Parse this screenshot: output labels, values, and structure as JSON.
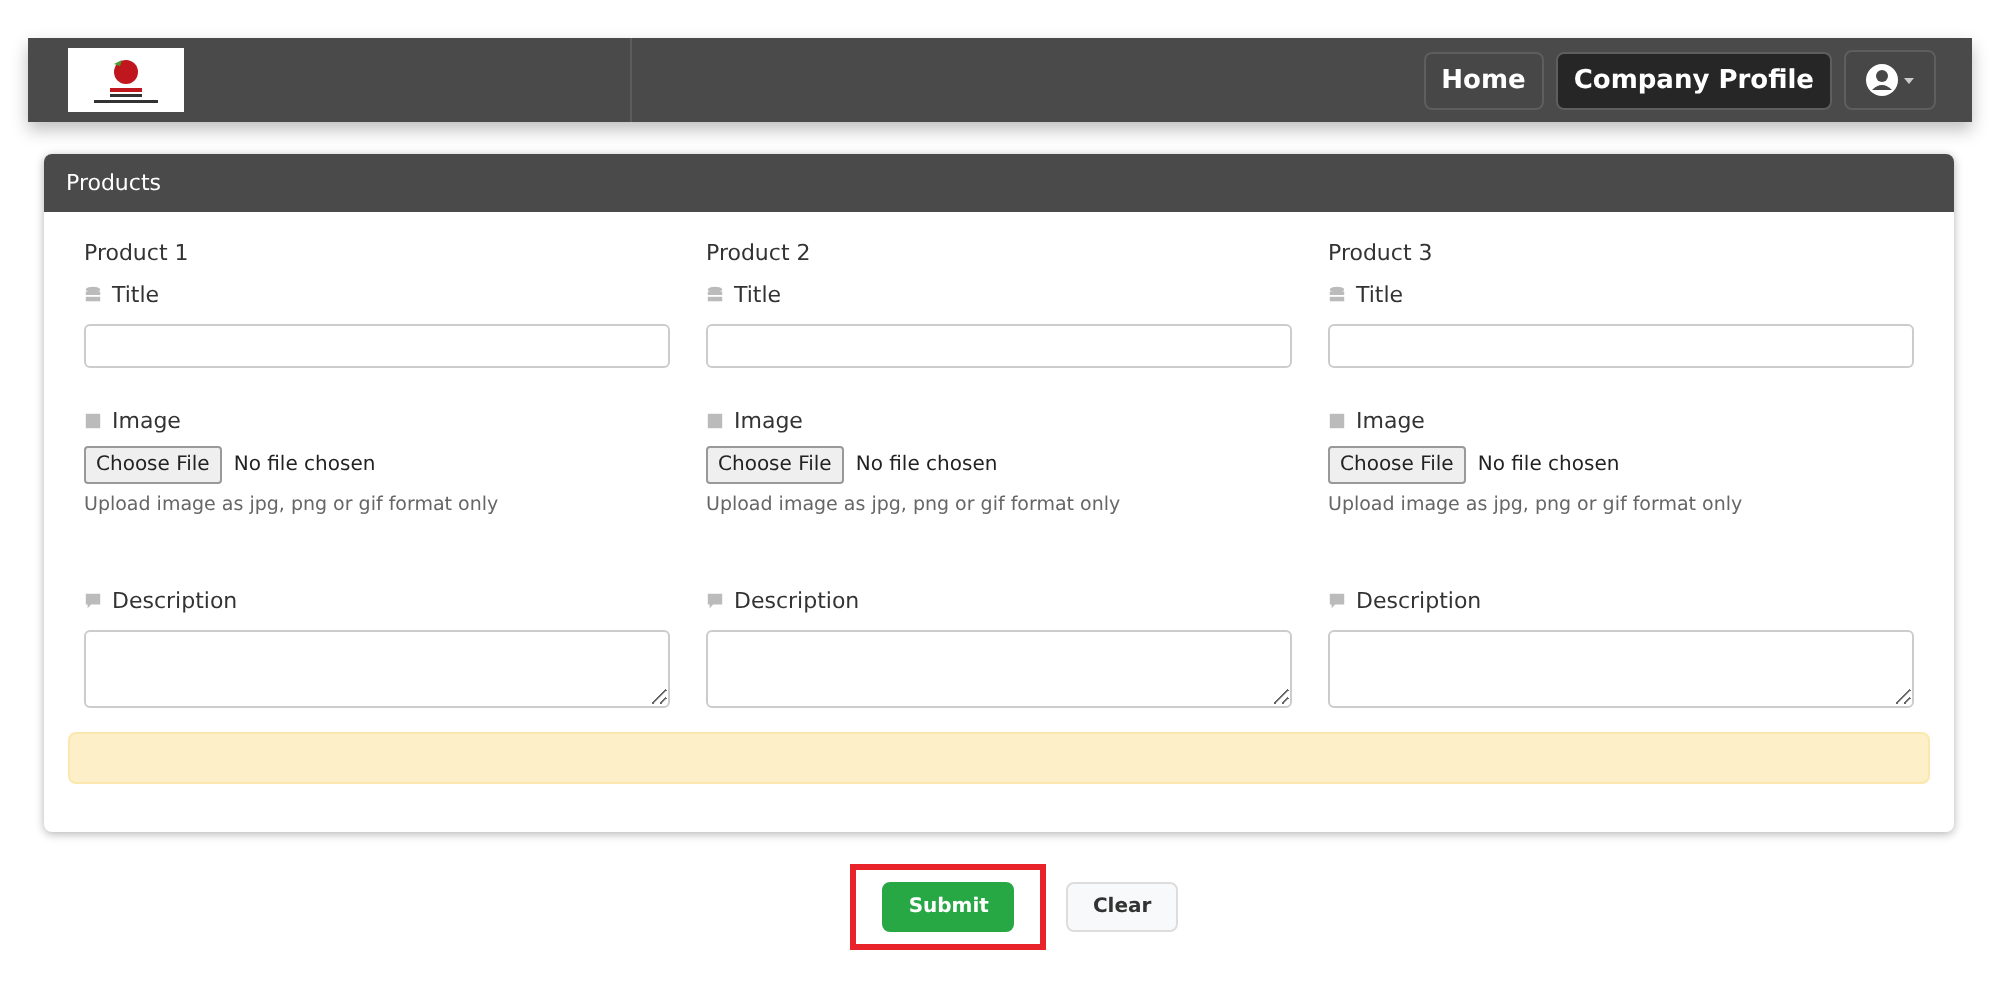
{
  "navbar": {
    "links": [
      {
        "label": "Home",
        "selected": false
      },
      {
        "label": "Company Profile",
        "selected": true
      }
    ]
  },
  "panel": {
    "title": "Products",
    "products": [
      {
        "heading": "Product 1",
        "title_label": "Title",
        "image_label": "Image",
        "file_button": "Choose File",
        "file_status": "No file chosen",
        "hint": "Upload image as jpg, png or gif format only",
        "description_label": "Description"
      },
      {
        "heading": "Product 2",
        "title_label": "Title",
        "image_label": "Image",
        "file_button": "Choose File",
        "file_status": "No file chosen",
        "hint": "Upload image as jpg, png or gif format only",
        "description_label": "Description"
      },
      {
        "heading": "Product 3",
        "title_label": "Title",
        "image_label": "Image",
        "file_button": "Choose File",
        "file_status": "No file chosen",
        "hint": "Upload image as jpg, png or gif format only",
        "description_label": "Description"
      }
    ]
  },
  "buttons": [
    {
      "label": "Submit",
      "kind": "primary",
      "highlighted": true
    },
    {
      "label": "Clear",
      "kind": "secondary",
      "highlighted": false
    }
  ]
}
